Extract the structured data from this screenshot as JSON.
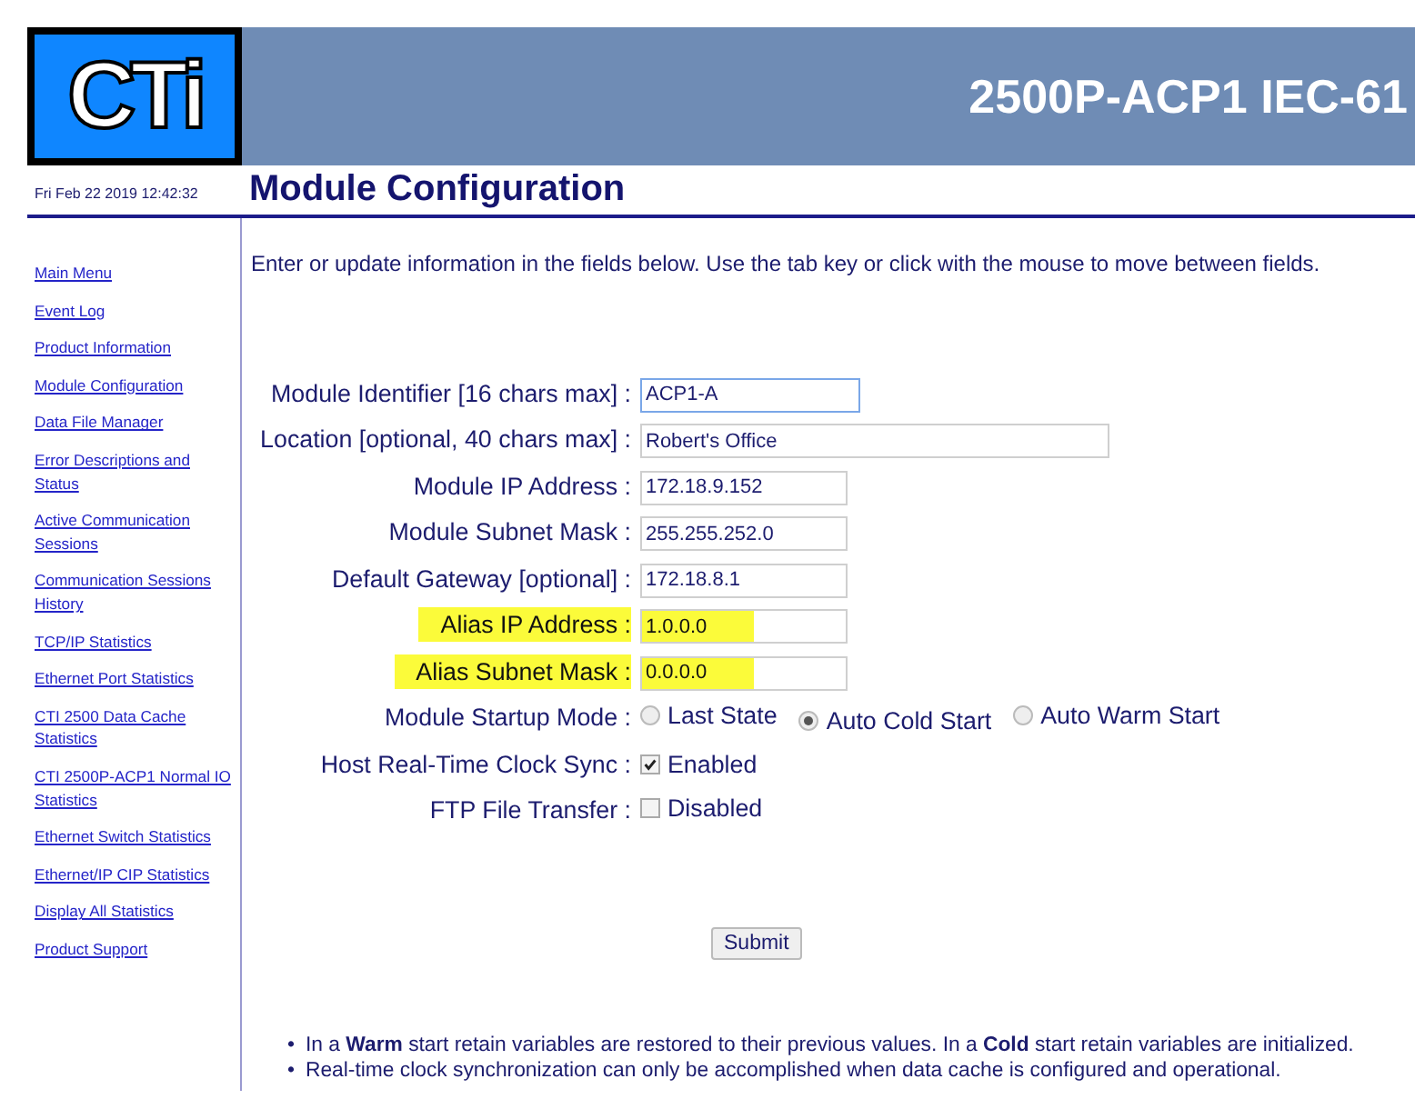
{
  "logo": {
    "text": "CTi"
  },
  "banner": {
    "title": "2500P-ACP1 IEC-61"
  },
  "datetime": "Fri Feb 22 2019 12:42:32",
  "page_title": "Module Configuration",
  "sidebar": {
    "items": [
      {
        "label": "Main Menu"
      },
      {
        "label": "Event Log"
      },
      {
        "label": "Product Information"
      },
      {
        "label": "Module Configuration"
      },
      {
        "label": "Data File Manager"
      },
      {
        "label": "Error Descriptions and Status"
      },
      {
        "label": "Active Communication Sessions"
      },
      {
        "label": "Communication Sessions History"
      },
      {
        "label": "TCP/IP Statistics"
      },
      {
        "label": "Ethernet Port Statistics"
      },
      {
        "label": "CTI 2500 Data Cache Statistics"
      },
      {
        "label": "CTI 2500P-ACP1 Normal IO Statistics"
      },
      {
        "label": "Ethernet Switch Statistics"
      },
      {
        "label": "Ethernet/IP CIP Statistics"
      },
      {
        "label": "Display All Statistics"
      },
      {
        "label": "Product Support"
      }
    ]
  },
  "intro": "Enter or update information in the fields below. Use the tab key or click with the mouse to move between fields.",
  "form": [
    {
      "kind": "text",
      "label": "Module Identifier [16 chars max] :",
      "value": "ACP1-A",
      "wide": false,
      "focused": true,
      "highlighted": false
    },
    {
      "kind": "text",
      "label": "Location [optional, 40 chars max] :",
      "value": "Robert's Office",
      "wide": true,
      "focused": false,
      "highlighted": false
    },
    {
      "kind": "text",
      "label": "Module IP Address :",
      "value": "172.18.9.152",
      "wide": false,
      "focused": false,
      "highlighted": false
    },
    {
      "kind": "text",
      "label": "Module Subnet Mask :",
      "value": "255.255.252.0",
      "wide": false,
      "focused": false,
      "highlighted": false
    },
    {
      "kind": "text",
      "label": "Default Gateway [optional] :",
      "value": "172.18.8.1",
      "wide": false,
      "focused": false,
      "highlighted": false
    },
    {
      "kind": "text",
      "label": "Alias IP Address :",
      "value": "1.0.0.0",
      "wide": false,
      "focused": false,
      "highlighted": true
    },
    {
      "kind": "text",
      "label": "Alias Subnet Mask :",
      "value": "0.0.0.0",
      "wide": false,
      "focused": false,
      "highlighted": true
    },
    {
      "kind": "radio",
      "label": "Module Startup Mode :",
      "options": [
        {
          "label": "Last State",
          "selected": false
        },
        {
          "label": "Auto Cold Start",
          "selected": true
        },
        {
          "label": "Auto Warm Start",
          "selected": false
        }
      ],
      "highlighted": false
    },
    {
      "kind": "checkbox",
      "label": "Host Real-Time Clock Sync :",
      "option": "Enabled",
      "checked": true,
      "highlighted": false
    },
    {
      "kind": "checkbox",
      "label": "FTP File Transfer :",
      "option": "Disabled",
      "checked": false,
      "highlighted": false
    }
  ],
  "submit": "Submit",
  "notes": [
    {
      "bullet": "•",
      "text": "In a **Warm** start retain variables are restored to their previous values. In a **Cold** start retain variables are initialized."
    },
    {
      "bullet": "•",
      "text": "Real-time clock synchronization can only be accomplished when data cache is configured and operational."
    }
  ]
}
